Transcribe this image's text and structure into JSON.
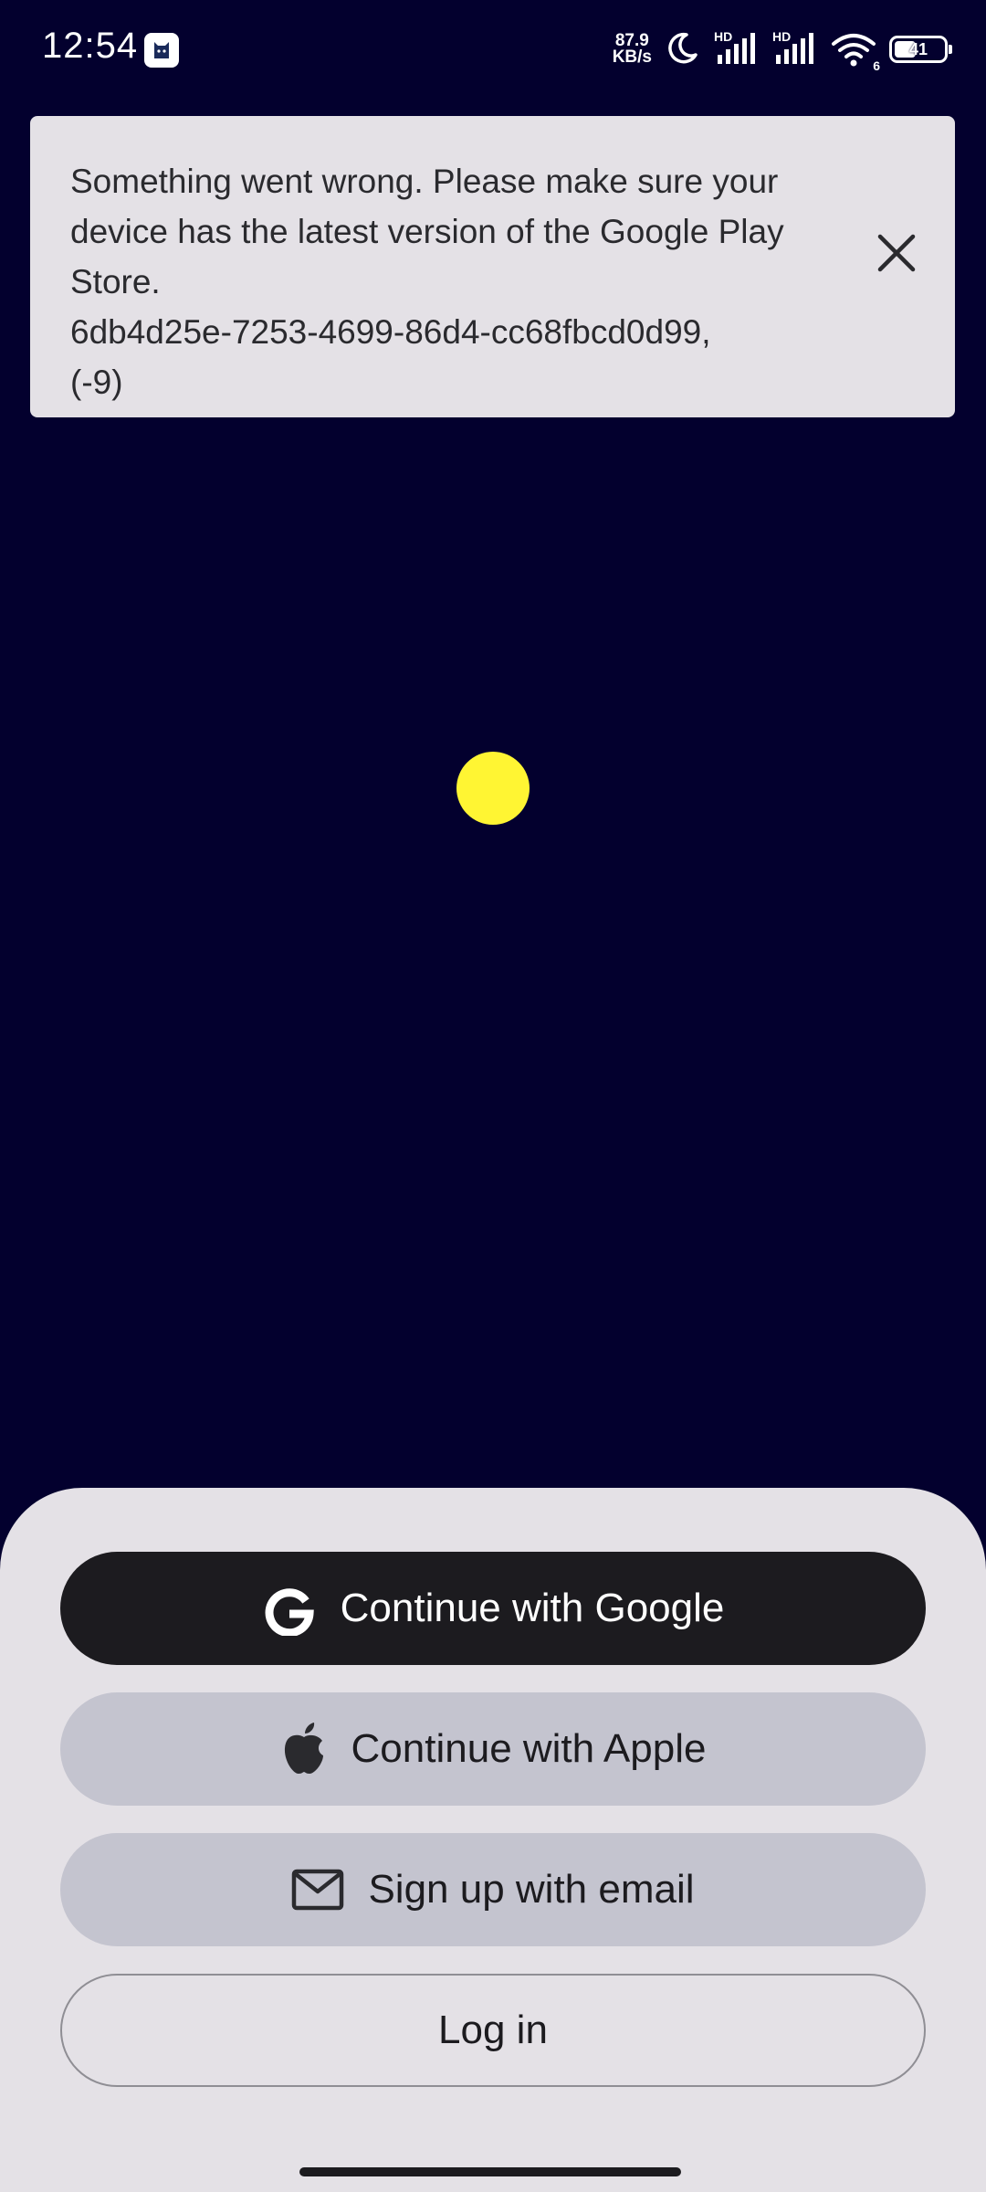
{
  "status_bar": {
    "time": "12:54",
    "net_speed_value": "87.9",
    "net_speed_unit": "KB/s",
    "hd1": "HD",
    "hd2": "HD",
    "wifi_badge": "6",
    "battery": "41"
  },
  "error_banner": {
    "message": "Something went wrong. Please make sure your device has the latest version of the Google Play Store.\n6db4d25e-7253-4699-86d4-cc68fbcd0d99,\n(-9)"
  },
  "loader": {
    "color": "#fff533"
  },
  "auth": {
    "google_label": "Continue with Google",
    "apple_label": "Continue with Apple",
    "email_label": "Sign up with email",
    "login_label": "Log in"
  },
  "colors": {
    "background": "#03002e",
    "sheet": "#e4e1e6",
    "primary_button": "#1c1b1f",
    "secondary_button": "#c4c4cf"
  }
}
